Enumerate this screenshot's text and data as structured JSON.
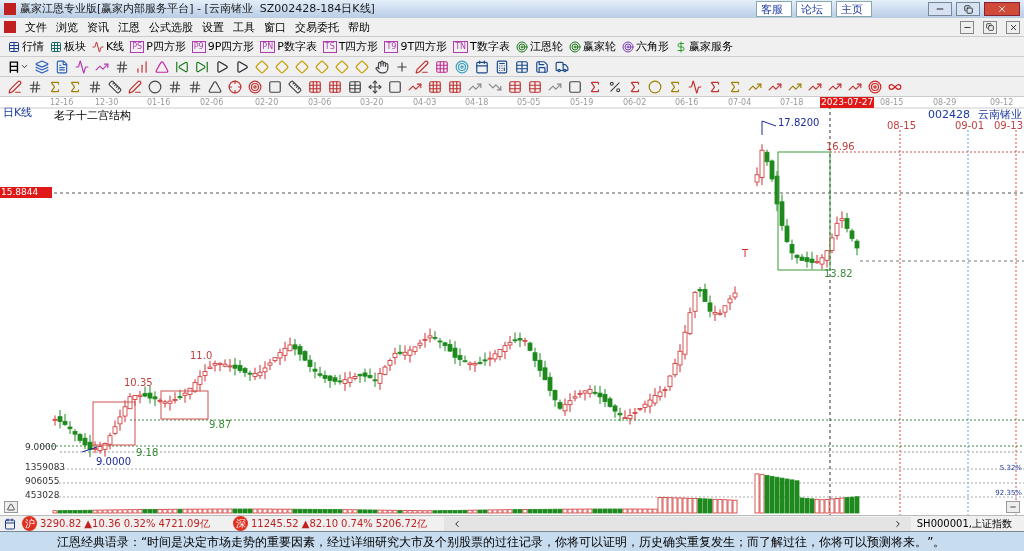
{
  "window": {
    "title": "赢家江恩专业版[赢家内部服务平台] - [云南锗业  SZ002428-184日K线]",
    "links": [
      "客服",
      "论坛",
      "主页"
    ]
  },
  "menu": [
    "文件",
    "浏览",
    "资讯",
    "江恩",
    "公式选股",
    "设置",
    "工具",
    "窗口",
    "交易委托",
    "帮助"
  ],
  "toolbar": [
    {
      "label": "行情"
    },
    {
      "label": "板块"
    },
    {
      "label": "K线"
    },
    {
      "label": "P四方形",
      "badge": "PS"
    },
    {
      "label": "9P四方形",
      "badge": "P9"
    },
    {
      "label": "P数字表",
      "badge": "PN"
    },
    {
      "label": "T四方形",
      "badge": "TS"
    },
    {
      "label": "9T四方形",
      "badge": "T9"
    },
    {
      "label": "T数字表",
      "badge": "TN"
    },
    {
      "label": "江恩轮"
    },
    {
      "label": "赢家轮"
    },
    {
      "label": "六角形"
    },
    {
      "label": "赢家服务"
    }
  ],
  "period_selector": "日",
  "chart": {
    "period_label": "日K线",
    "title": "老子十二宫结构",
    "code": "002428",
    "name": "云南锗业",
    "dates": [
      {
        "label": "12-16",
        "highlighted": false
      },
      {
        "label": "12-30",
        "highlighted": false
      },
      {
        "label": "01-16",
        "highlighted": false
      },
      {
        "label": "02-06",
        "highlighted": false
      },
      {
        "label": "02-20",
        "highlighted": false
      },
      {
        "label": "03-06",
        "highlighted": false
      },
      {
        "label": "03-20",
        "highlighted": false
      },
      {
        "label": "04-03",
        "highlighted": false
      },
      {
        "label": "04-18",
        "highlighted": false
      },
      {
        "label": "05-05",
        "highlighted": false
      },
      {
        "label": "05-19",
        "highlighted": false
      },
      {
        "label": "06-02",
        "highlighted": false
      },
      {
        "label": "06-16",
        "highlighted": false
      },
      {
        "label": "07-04",
        "highlighted": false
      },
      {
        "label": "07-18",
        "highlighted": false
      },
      {
        "label": "2023-07-27",
        "highlighted": true
      },
      {
        "label": "08-15",
        "highlighted": false
      },
      {
        "label": "08-29",
        "highlighted": false
      },
      {
        "label": "09-12",
        "highlighted": false
      }
    ],
    "price_labels": [
      {
        "text": "15.8844",
        "kind": "marker"
      },
      {
        "text": "9.0000",
        "kind": "plain"
      }
    ],
    "volume_labels": [
      "1359083",
      "906055",
      "453028"
    ],
    "right_labels": [
      "5.32%",
      "92.35%"
    ],
    "annotations": [
      {
        "text": "17.8200",
        "color": "#1a2a9c"
      },
      {
        "text": "16.96",
        "color": "#c04040"
      },
      {
        "text": "13.82",
        "color": "#3a8a3a"
      },
      {
        "text": "10.35",
        "color": "#c04040"
      },
      {
        "text": "11.0",
        "color": "#c04040"
      },
      {
        "text": "9.87",
        "color": "#3a8a3a"
      },
      {
        "text": "9.18",
        "color": "#3a8a3a"
      },
      {
        "text": "9.0000",
        "color": "#1a2a9c"
      },
      {
        "text": "T",
        "color": "#d03030"
      },
      {
        "text": "08-15",
        "color": "#c04040"
      },
      {
        "text": "09-01",
        "color": "#c04040"
      },
      {
        "text": "09-13",
        "color": "#c04040"
      }
    ]
  },
  "status_bar": {
    "indices": [
      {
        "badge": "沪",
        "price": "3290.82",
        "change": "▲10.36",
        "percent": "0.32%",
        "amount": "4721.09亿"
      },
      {
        "badge": "深",
        "price": "11245.52",
        "change": "▲82.10",
        "percent": "0.74%",
        "amount": "5206.72亿"
      }
    ],
    "symbol": "SH000001,上证指数"
  },
  "quote": "江恩经典语录：“时间是决定市场走势的重要因素，经过详细研究大市及个别股票的过往记录，你将可以证明，历史确实重复发生；而了解过往，你将可以预测将来。”。"
}
